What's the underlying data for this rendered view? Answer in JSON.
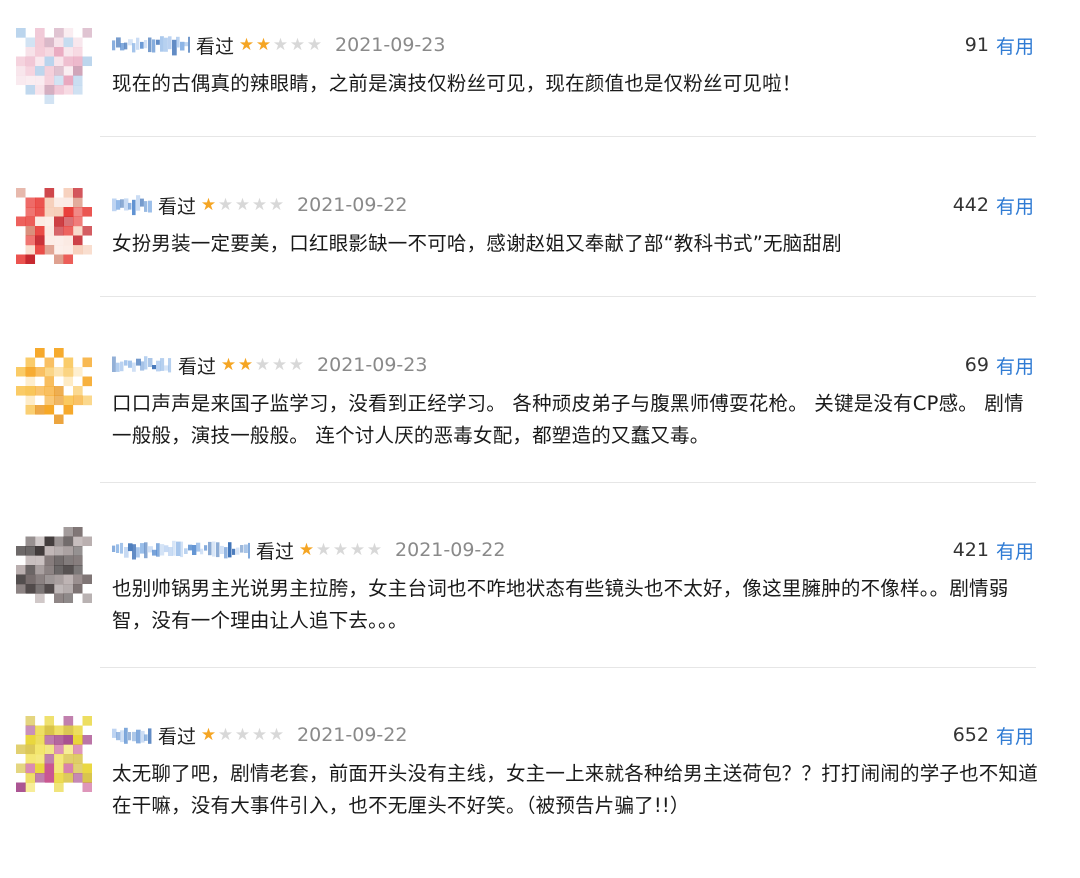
{
  "reviews": [
    {
      "watched_label": "看过",
      "rating": 2,
      "date": "2021-09-23",
      "votes": "91",
      "useful_label": "有用",
      "text": "现在的古偶真的辣眼睛，之前是演技仅粉丝可见，现在颜值也是仅粉丝可见啦！",
      "avatar_colors": [
        "#f3c9d6",
        "#e9a9c0",
        "#b8d3ec",
        "#f7e2e9",
        "#cfa3b8"
      ]
    },
    {
      "watched_label": "看过",
      "rating": 1,
      "date": "2021-09-22",
      "votes": "442",
      "useful_label": "有用",
      "text": "女扮男装一定要美，口红眼影缺一不可哈，感谢赵姐又奉献了部“教科书式”无脑甜剧",
      "avatar_colors": [
        "#e83a35",
        "#c41e25",
        "#f5c9b2",
        "#d98e7a",
        "#fbe9e2"
      ]
    },
    {
      "watched_label": "看过",
      "rating": 2,
      "date": "2021-09-23",
      "votes": "69",
      "useful_label": "有用",
      "text": "口口声声是来国子监学习，没看到正经学习。 各种顽皮弟子与腹黑师傅耍花枪。 关键是没有CP感。 剧情一般般，演技一般般。 连个讨人厌的恶毒女配，都塑造的又蠢又毒。",
      "avatar_colors": [
        "#f6a623",
        "#f9c24d",
        "#fde4b0",
        "#e8941a",
        "#ffffff"
      ]
    },
    {
      "watched_label": "看过",
      "rating": 1,
      "date": "2021-09-22",
      "votes": "421",
      "useful_label": "有用",
      "text": "也别帅锅男主光说男主拉胯，女主台词也不咋地状态有些镜头也不太好，像这里臃肿的不像样。。剧情弱智，没有一个理由让人追下去。。。",
      "avatar_colors": [
        "#3a3434",
        "#6d6262",
        "#9a8f8f",
        "#4f4747",
        "#b9aeae"
      ]
    },
    {
      "watched_label": "看过",
      "rating": 1,
      "date": "2021-09-22",
      "votes": "652",
      "useful_label": "有用",
      "text": "太无聊了吧，剧情老套，前面开头没有主线，女主一上来就各种给男主送荷包？？打打闹闹的学子也不知道在干嘛，没有大事件引入，也不无厘头不好笑。（被预告片骗了!!）",
      "avatar_colors": [
        "#e9d63a",
        "#c9548f",
        "#f3e56b",
        "#a64a8c",
        "#d9c44b"
      ]
    }
  ]
}
